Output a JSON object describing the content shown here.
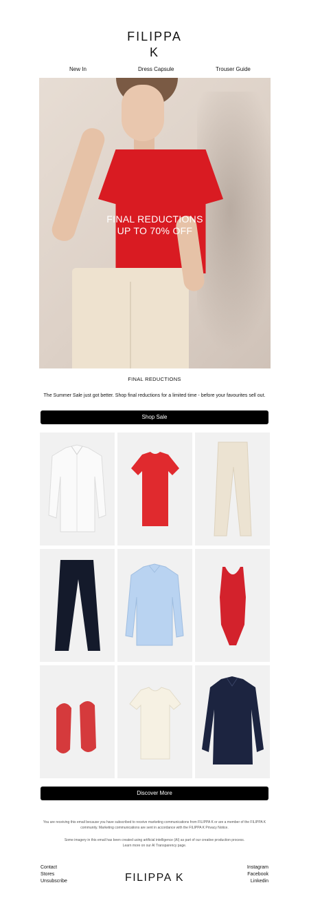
{
  "brand": {
    "logo_line1": "FILIPPA",
    "logo_line2": "K"
  },
  "nav": {
    "items": [
      "New In",
      "Dress Capsule",
      "Trouser Guide"
    ]
  },
  "hero": {
    "line1": "FINAL REDUCTIONS",
    "line2": "UP TO 70% OFF"
  },
  "section": {
    "title": "FINAL REDUCTIONS",
    "body": "The Summer Sale just got better. Shop final reductions for a limited time - before your favourites sell out."
  },
  "buttons": {
    "shop_label": "Shop Sale",
    "discover_label": "Discover More"
  },
  "products": [
    {
      "icon": "white-shirt",
      "color": "#fafafa"
    },
    {
      "icon": "red-tshirt",
      "color": "#e02a2e"
    },
    {
      "icon": "cream-trousers",
      "color": "#ece3d2"
    },
    {
      "icon": "navy-trousers",
      "color": "#141a2b"
    },
    {
      "icon": "light-blue-shirt",
      "color": "#b9d3f1"
    },
    {
      "icon": "red-swimsuit",
      "color": "#d3222c"
    },
    {
      "icon": "red-ballet-flats",
      "color": "#d53a3c"
    },
    {
      "icon": "cream-tshirt",
      "color": "#f6f1e3"
    },
    {
      "icon": "navy-shirt",
      "color": "#1c2440"
    }
  ],
  "legal": {
    "p1": "You are receiving this email because you have subscribed to receive marketing communications from FILIPPA K or are a member of the FILIPPA K community. Marketing communications are sent in accordance with the FILIPPA K Privacy Notice.",
    "p2a": "Some imagery in this email has been created using artificial intelligence (AI) as part of our creative production process.",
    "p2b": "Learn more on our AI Transparency page."
  },
  "footer": {
    "left": [
      "Contact",
      "Stores",
      "Unsubscribe"
    ],
    "right": [
      "Instagram",
      "Facebook",
      "Linkedin"
    ],
    "logo": "FILIPPA K"
  }
}
